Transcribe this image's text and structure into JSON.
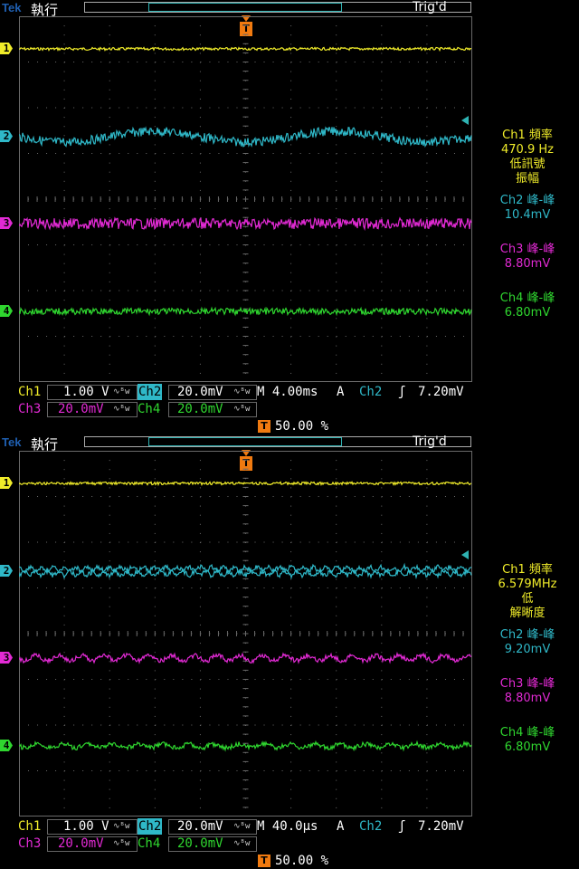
{
  "colors": {
    "ch1": "#f0ec2a",
    "ch2": "#2fb8c8",
    "ch3": "#e22ad4",
    "ch4": "#2fd62f",
    "grid": "#6a6a6a",
    "trigger": "#f07a10"
  },
  "screens": [
    {
      "brand": "Tek",
      "mode": "執行",
      "trig_state": "Trig'd",
      "trig_marker": "T",
      "channel_markers": [
        "1",
        "2",
        "3",
        "4"
      ],
      "readouts": [
        {
          "ch": "ch1",
          "lines": [
            "Ch1 頻率",
            "470.9 Hz",
            "低訊號",
            "振幅"
          ]
        },
        {
          "ch": "ch2",
          "lines": [
            "Ch2 峰-峰",
            "10.4mV"
          ]
        },
        {
          "ch": "ch3",
          "lines": [
            "Ch3 峰-峰",
            "8.80mV"
          ]
        },
        {
          "ch": "ch4",
          "lines": [
            "Ch4 峰-峰",
            "6.80mV"
          ]
        }
      ],
      "settings": {
        "ch1_label": "Ch1",
        "ch1_scale": "1.00 V",
        "ch2_label": "Ch2",
        "ch2_scale": "20.0mV",
        "ch3_label": "Ch3",
        "ch3_scale": "20.0mV",
        "ch4_label": "Ch4",
        "ch4_scale": "20.0mV",
        "bw_symbol": "∿ᴮw",
        "timebase": "M 4.00ms",
        "trig_mode": "A",
        "trig_source": "Ch2",
        "trig_slope": "ʃ",
        "trig_level": "7.20mV",
        "trig_position": "50.00 %"
      },
      "wave2": {
        "type": "sine",
        "cycles": 2.5,
        "noise": "high"
      }
    },
    {
      "brand": "Tek",
      "mode": "執行",
      "trig_state": "Trig'd",
      "trig_marker": "T",
      "channel_markers": [
        "1",
        "2",
        "3",
        "4"
      ],
      "readouts": [
        {
          "ch": "ch1",
          "lines": [
            "Ch1 頻率",
            "6.579MHz",
            "低",
            "解晰度"
          ]
        },
        {
          "ch": "ch2",
          "lines": [
            "Ch2 峰-峰",
            "9.20mV"
          ]
        },
        {
          "ch": "ch3",
          "lines": [
            "Ch3 峰-峰",
            "8.80mV"
          ]
        },
        {
          "ch": "ch4",
          "lines": [
            "Ch4 峰-峰",
            "6.80mV"
          ]
        }
      ],
      "settings": {
        "ch1_label": "Ch1",
        "ch1_scale": "1.00 V",
        "ch2_label": "Ch2",
        "ch2_scale": "20.0mV",
        "ch3_label": "Ch3",
        "ch3_scale": "20.0mV",
        "ch4_label": "Ch4",
        "ch4_scale": "20.0mV",
        "bw_symbol": "∿ᴮw",
        "timebase": "M 40.0µs",
        "trig_mode": "A",
        "trig_source": "Ch2",
        "trig_slope": "ʃ",
        "trig_level": "7.20mV",
        "trig_position": "50.00 %"
      },
      "wave2": {
        "type": "zigzag",
        "cycles": 20,
        "noise": "medium"
      }
    }
  ]
}
